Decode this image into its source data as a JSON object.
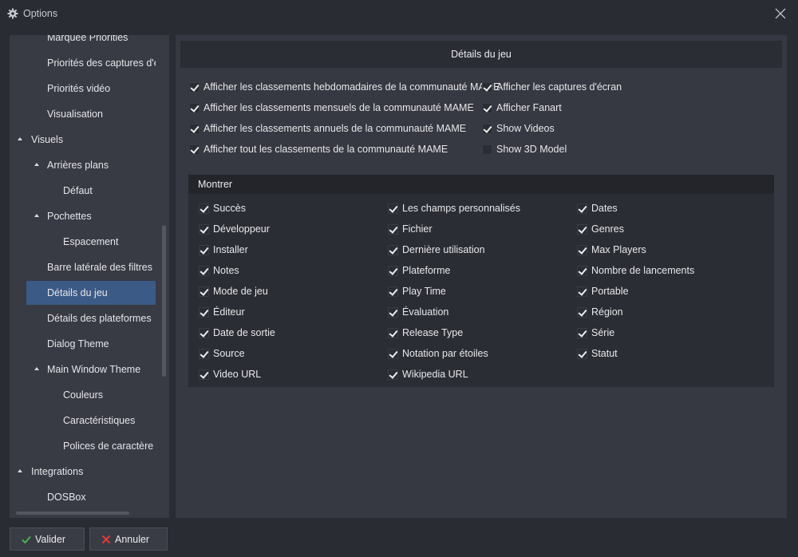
{
  "window": {
    "title": "Options"
  },
  "sidebar": {
    "items": [
      {
        "label": "Marquee Priorities",
        "indent": 1,
        "expanded": null,
        "selected": false
      },
      {
        "label": "Priorités des captures d'écran",
        "indent": 1,
        "expanded": null,
        "selected": false
      },
      {
        "label": "Priorités vidéo",
        "indent": 1,
        "expanded": null,
        "selected": false
      },
      {
        "label": "Visualisation",
        "indent": 1,
        "expanded": null,
        "selected": false
      },
      {
        "label": "Visuels",
        "indent": 0,
        "expanded": true,
        "selected": false
      },
      {
        "label": "Arrières plans",
        "indent": 1,
        "expanded": true,
        "selected": false
      },
      {
        "label": "Défaut",
        "indent": 2,
        "expanded": null,
        "selected": false
      },
      {
        "label": "Pochettes",
        "indent": 1,
        "expanded": true,
        "selected": false
      },
      {
        "label": "Espacement",
        "indent": 2,
        "expanded": null,
        "selected": false
      },
      {
        "label": "Barre latérale des filtres",
        "indent": 1,
        "expanded": null,
        "selected": false
      },
      {
        "label": "Détails du jeu",
        "indent": 1,
        "expanded": null,
        "selected": true
      },
      {
        "label": "Détails des plateformes",
        "indent": 1,
        "expanded": null,
        "selected": false
      },
      {
        "label": "Dialog Theme",
        "indent": 1,
        "expanded": null,
        "selected": false
      },
      {
        "label": "Main Window Theme",
        "indent": 1,
        "expanded": true,
        "selected": false
      },
      {
        "label": "Couleurs",
        "indent": 2,
        "expanded": null,
        "selected": false
      },
      {
        "label": "Caractéristiques",
        "indent": 2,
        "expanded": null,
        "selected": false
      },
      {
        "label": "Polices de caractère",
        "indent": 2,
        "expanded": null,
        "selected": false
      },
      {
        "label": "Integrations",
        "indent": 0,
        "expanded": true,
        "selected": false
      },
      {
        "label": "DOSBox",
        "indent": 1,
        "expanded": null,
        "selected": false
      }
    ]
  },
  "main": {
    "header": "Détails du jeu",
    "top_options": [
      {
        "label": "Afficher les classements hebdomadaires de la communauté MAME",
        "checked": true
      },
      {
        "label": "Afficher les classements mensuels de la communauté MAME",
        "checked": true
      },
      {
        "label": "Afficher les classements annuels de la communauté MAME",
        "checked": true
      },
      {
        "label": "Afficher tout les classements de la communauté MAME",
        "checked": true
      },
      {
        "label": "Afficher les captures d'écran",
        "checked": true
      },
      {
        "label": "Afficher Fanart",
        "checked": true
      },
      {
        "label": "Show Videos",
        "checked": true
      },
      {
        "label": "Show 3D Model",
        "checked": false
      }
    ],
    "show_section": {
      "title": "Montrer",
      "columns": [
        [
          {
            "label": "Succès",
            "checked": true
          },
          {
            "label": "Développeur",
            "checked": true
          },
          {
            "label": "Installer",
            "checked": true
          },
          {
            "label": "Notes",
            "checked": true
          },
          {
            "label": "Mode de jeu",
            "checked": true
          },
          {
            "label": "Éditeur",
            "checked": true
          },
          {
            "label": "Date de sortie",
            "checked": true
          },
          {
            "label": "Source",
            "checked": true
          },
          {
            "label": "Video URL",
            "checked": true
          }
        ],
        [
          {
            "label": "Les champs personnalisés",
            "checked": true
          },
          {
            "label": "Fichier",
            "checked": true
          },
          {
            "label": "Dernière utilisation",
            "checked": true
          },
          {
            "label": "Plateforme",
            "checked": true
          },
          {
            "label": "Play Time",
            "checked": true
          },
          {
            "label": "Évaluation",
            "checked": true
          },
          {
            "label": "Release Type",
            "checked": true
          },
          {
            "label": "Notation par étoiles",
            "checked": true
          },
          {
            "label": "Wikipedia URL",
            "checked": true
          }
        ],
        [
          {
            "label": "Dates",
            "checked": true
          },
          {
            "label": "Genres",
            "checked": true
          },
          {
            "label": "Max Players",
            "checked": true
          },
          {
            "label": "Nombre de lancements",
            "checked": true
          },
          {
            "label": "Portable",
            "checked": true
          },
          {
            "label": "Région",
            "checked": true
          },
          {
            "label": "Série",
            "checked": true
          },
          {
            "label": "Statut",
            "checked": true
          }
        ]
      ]
    }
  },
  "footer": {
    "ok_label": "Valider",
    "cancel_label": "Annuler"
  },
  "colors": {
    "accent": "#3c5a86",
    "ok_icon": "#4caf50",
    "cancel_icon": "#e53935"
  },
  "icons": {
    "title": "gear-icon",
    "close": "close-icon",
    "ok": "check-icon",
    "cancel": "x-icon"
  }
}
